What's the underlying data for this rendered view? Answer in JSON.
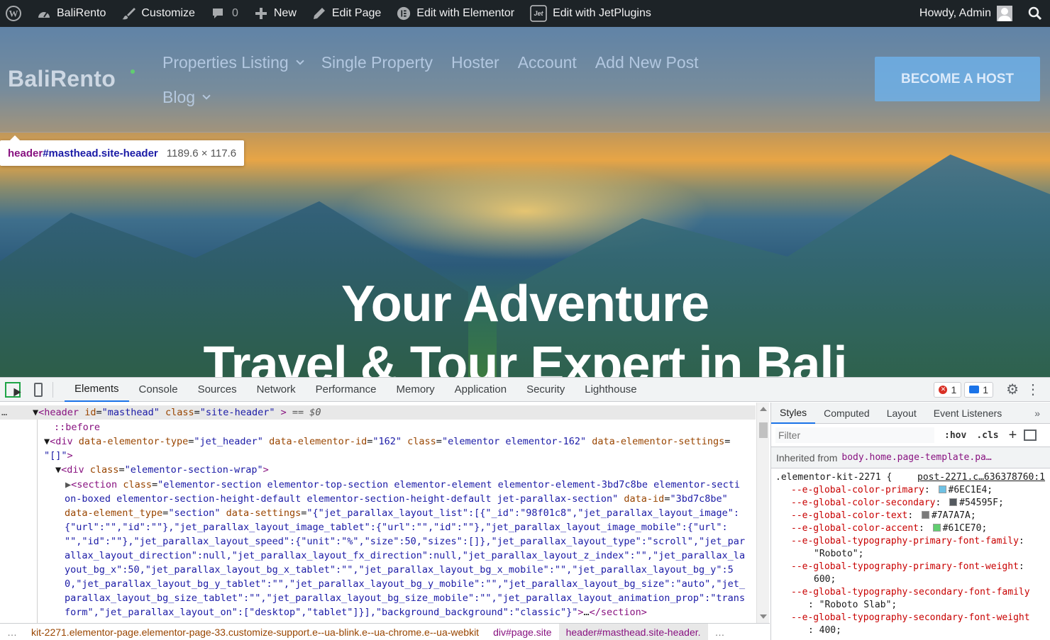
{
  "admin_bar": {
    "site_name": "BaliRento",
    "customize": "Customize",
    "comments_count": "0",
    "new": "New",
    "edit_page": "Edit Page",
    "edit_elementor": "Edit with Elementor",
    "edit_jetplugins": "Edit with JetPlugins",
    "howdy": "Howdy, Admin"
  },
  "site": {
    "logo": "BaliRento",
    "nav": [
      "Properties Listing",
      "Single Property",
      "Hoster",
      "Account",
      "Add New Post",
      "Blog"
    ],
    "cta": "BECOME A HOST",
    "hero_line1": "Your Adventure",
    "hero_line2": "Travel & Tour Expert in Bali"
  },
  "inspect_tooltip": {
    "tag": "header",
    "selector": "#masthead.site-header",
    "size": "1189.6 × 117.6"
  },
  "devtools": {
    "tabs": [
      "Elements",
      "Console",
      "Sources",
      "Network",
      "Performance",
      "Memory",
      "Application",
      "Security",
      "Lighthouse"
    ],
    "active_tab": "Elements",
    "errors": "1",
    "messages": "1",
    "styles_tabs": [
      "Styles",
      "Computed",
      "Layout",
      "Event Listeners"
    ],
    "filter_placeholder": "Filter",
    "hov": ":hov",
    "cls": ".cls",
    "inherited_label": "Inherited from",
    "inherited_from": "body.home.page-template.pa…",
    "rule_selector": ".elementor-kit-2271 {",
    "rule_source": "post-2271.c…636378760:1",
    "properties": [
      {
        "name": "--e-global-color-primary",
        "value": "#6EC1E4",
        "color": "#6EC1E4"
      },
      {
        "name": "--e-global-color-secondary",
        "value": "#54595F",
        "color": "#54595F"
      },
      {
        "name": "--e-global-color-text",
        "value": "#7A7A7A",
        "color": "#7A7A7A"
      },
      {
        "name": "--e-global-color-accent",
        "value": "#61CE70",
        "color": "#61CE70"
      },
      {
        "name": "--e-global-typography-primary-font-family",
        "value": "\"Roboto\""
      },
      {
        "name": "--e-global-typography-primary-font-weight",
        "value": "600"
      },
      {
        "name": "--e-global-typography-secondary-font-family",
        "value": "\"Roboto Slab\""
      },
      {
        "name": "--e-global-typography-secondary-font-weight",
        "value": "400"
      }
    ],
    "breadcrumbs": [
      "kit-2271.elementor-page.elementor-page-33.customize-support.e--ua-blink.e--ua-chrome.e--ua-webkit",
      "div#page.site",
      "header#masthead.site-header."
    ]
  }
}
